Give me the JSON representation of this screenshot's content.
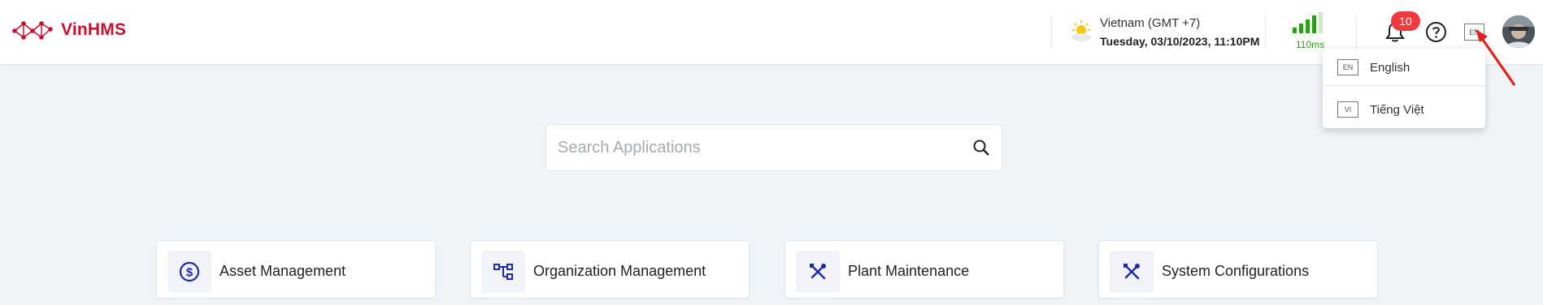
{
  "header": {
    "app_name": "VinHMS",
    "timezone": "Vietnam (GMT +7)",
    "datetime": "Tuesday, 03/10/2023, 11:10PM",
    "ping": "110ms",
    "notifications_count": "10",
    "language_code": "EN",
    "brand_color": "#c8102e"
  },
  "language_menu": {
    "items": [
      {
        "code": "EN",
        "label": "English"
      },
      {
        "code": "VI",
        "label": "Tiếng Việt"
      }
    ]
  },
  "search": {
    "placeholder": "Search Applications",
    "value": ""
  },
  "apps": [
    {
      "title": "Asset Management",
      "icon": "dollar-circle-icon"
    },
    {
      "title": "Organization Management",
      "icon": "org-chart-icon"
    },
    {
      "title": "Plant Maintenance",
      "icon": "tools-icon"
    },
    {
      "title": "System Configurations",
      "icon": "tools-icon"
    }
  ]
}
